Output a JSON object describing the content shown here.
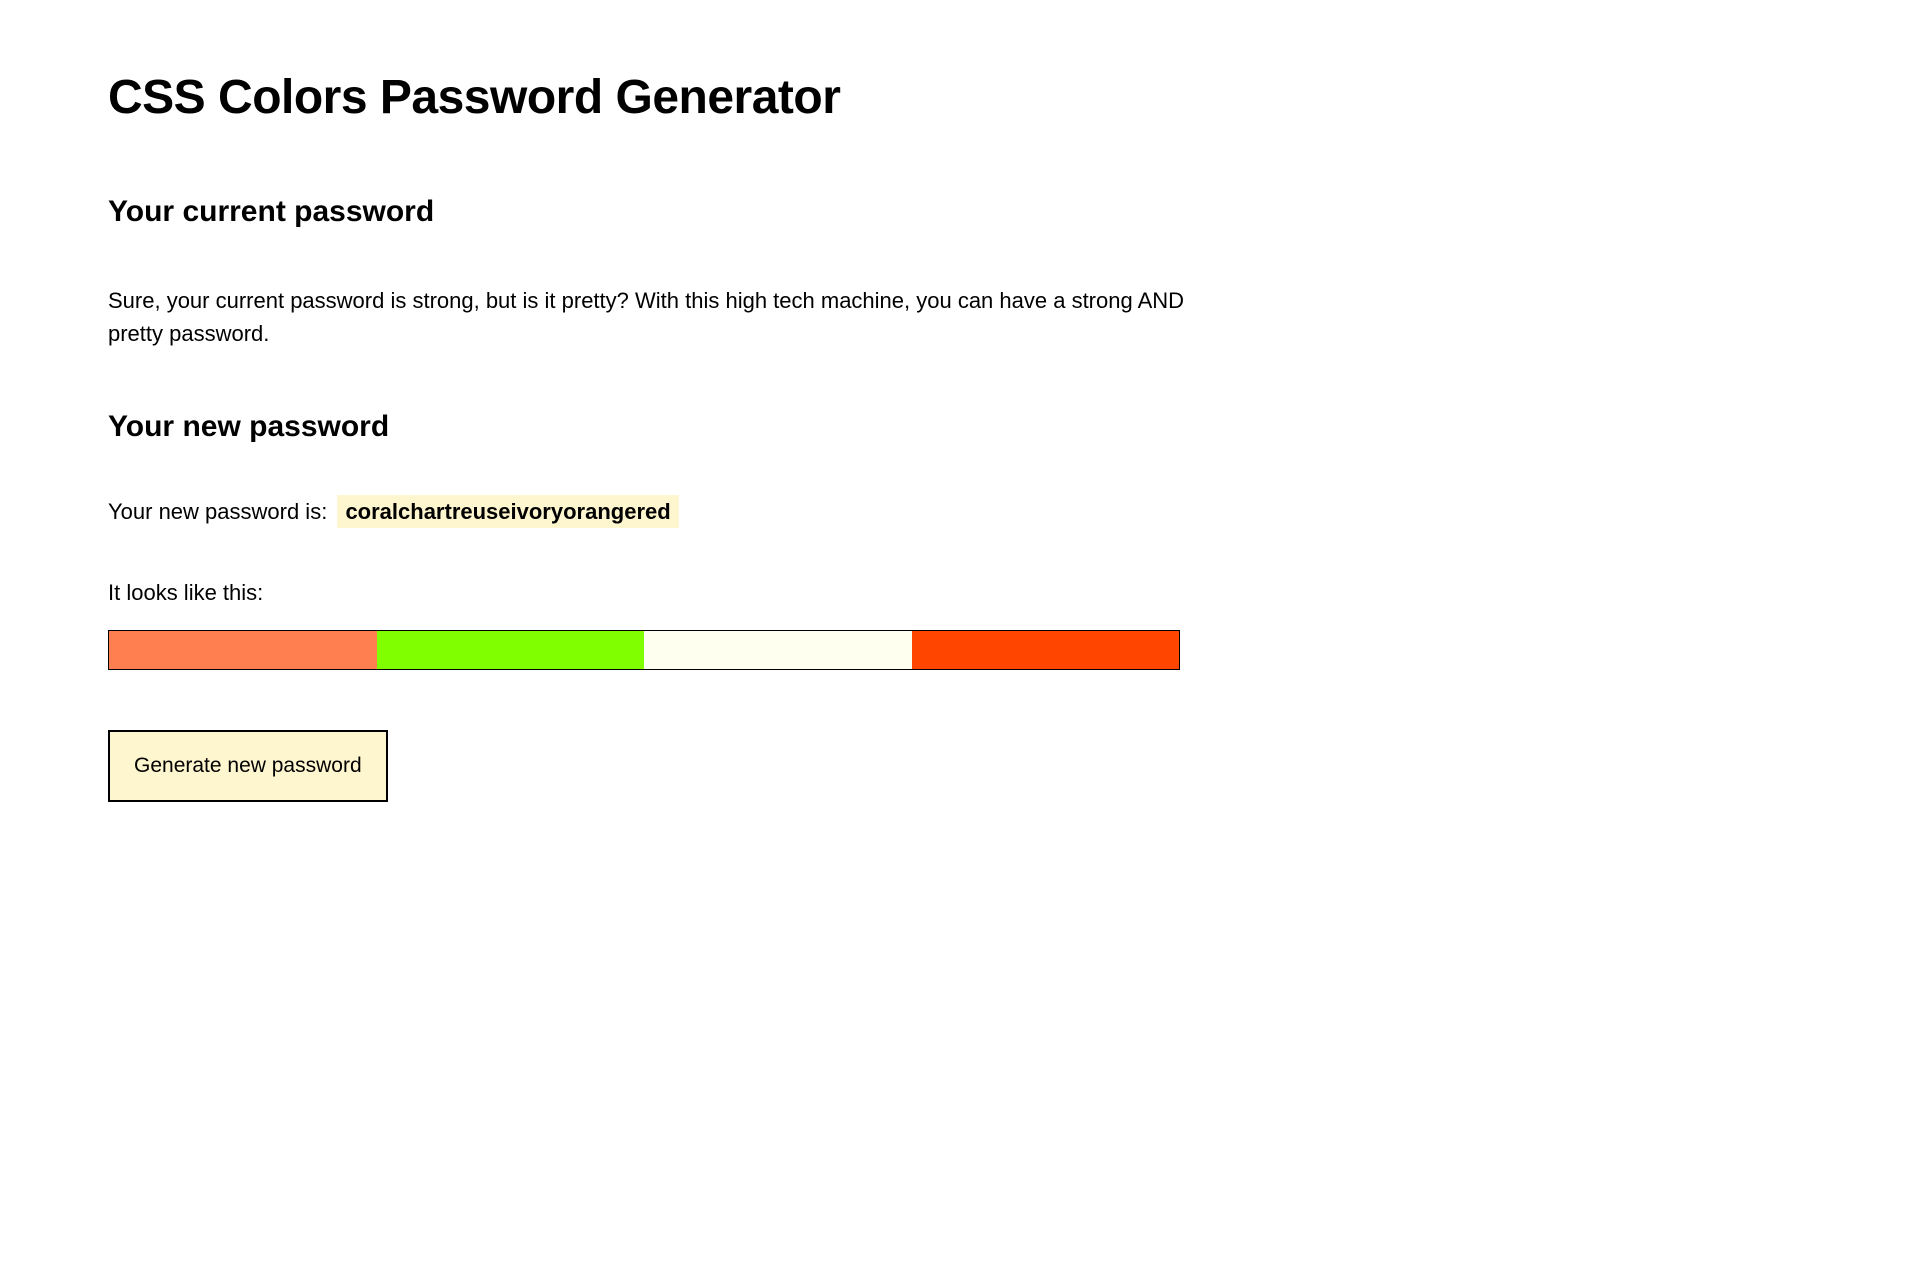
{
  "page": {
    "title": "CSS Colors Password Generator"
  },
  "currentPassword": {
    "heading": "Your current password",
    "description": "Sure, your current password is strong, but is it pretty? With this high tech machine, you can have a strong AND pretty password."
  },
  "newPassword": {
    "heading": "Your new password",
    "label": "Your new password is:",
    "value": "coralchartreuseivoryorangered",
    "previewLabel": "It looks like this:",
    "colors": [
      {
        "name": "coral",
        "hex": "#FF7F50"
      },
      {
        "name": "chartreuse",
        "hex": "#7FFF00"
      },
      {
        "name": "ivory",
        "hex": "#FFFFF0"
      },
      {
        "name": "orangered",
        "hex": "#FF4500"
      }
    ]
  },
  "actions": {
    "generateLabel": "Generate new password"
  },
  "theme": {
    "highlightBg": "#FEF6CE"
  }
}
